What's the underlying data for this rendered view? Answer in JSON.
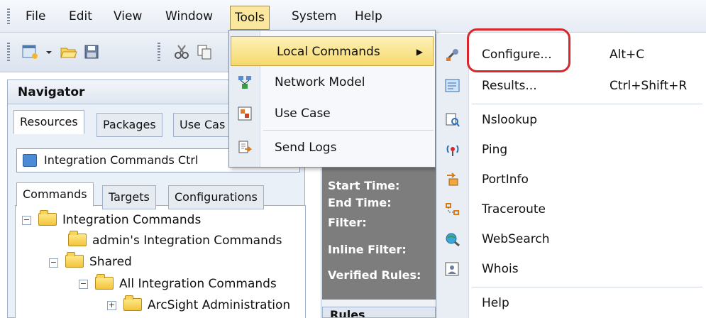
{
  "menubar": {
    "items": [
      "File",
      "Edit",
      "View",
      "Window",
      "Tools",
      "System",
      "Help"
    ],
    "active": "Tools"
  },
  "navigator": {
    "title": "Navigator",
    "top_tabs": [
      "Resources",
      "Packages",
      "Use Cas"
    ],
    "combo_text": "Integration Commands   Ctrl",
    "sub_tabs": [
      "Commands",
      "Targets",
      "Configurations"
    ],
    "tree": [
      "Integration Commands",
      "admin's Integration Commands",
      "Shared",
      "All Integration Commands",
      "ArcSight Administration"
    ]
  },
  "details": {
    "labels": [
      "Start Time:",
      "End Time:",
      "Filter:",
      "Inline Filter:",
      "Verified Rules:"
    ],
    "bottom_tab": "Rules"
  },
  "tools_menu": {
    "items": [
      {
        "label": "Local Commands",
        "icon": "local-commands-icon",
        "submenu": true
      },
      {
        "label": "Network Model",
        "icon": "network-model-icon"
      },
      {
        "label": "Use Case",
        "icon": "use-case-icon"
      },
      {
        "label": "Send Logs",
        "icon": "send-logs-icon"
      }
    ]
  },
  "submenu": {
    "items": [
      {
        "label": "Configure...",
        "shortcut": "Alt+C",
        "icon": "wrench-icon"
      },
      {
        "label": "Results...",
        "shortcut": "Ctrl+Shift+R",
        "icon": "results-icon"
      },
      {
        "label": "Nslookup",
        "shortcut": "",
        "icon": "nslookup-icon"
      },
      {
        "label": "Ping",
        "shortcut": "",
        "icon": "ping-icon"
      },
      {
        "label": "PortInfo",
        "shortcut": "",
        "icon": "portinfo-icon"
      },
      {
        "label": "Traceroute",
        "shortcut": "",
        "icon": "traceroute-icon"
      },
      {
        "label": "WebSearch",
        "shortcut": "",
        "icon": "websearch-icon"
      },
      {
        "label": "Whois",
        "shortcut": "",
        "icon": "whois-icon"
      },
      {
        "label": "Help",
        "shortcut": "",
        "icon": ""
      }
    ]
  },
  "colors": {
    "highlight": "#f6d96c",
    "callout": "#d8262d",
    "dark_panel": "#7d7d7d"
  }
}
